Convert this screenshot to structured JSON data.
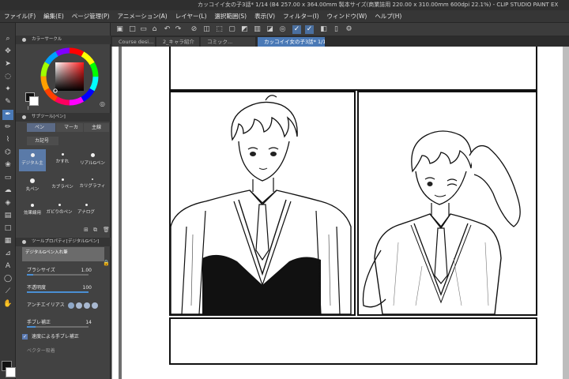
{
  "window": {
    "title": "カッコイイ女の子3話* 1/14 (B4 257.00 x 364.00mm 製本サイズ(商業誌用 220.00 x 310.00mm 600dpi 22.1%) - CLIP STUDIO PAINT EX"
  },
  "menu": [
    "ファイル(F)",
    "編集(E)",
    "ページ管理(P)",
    "アニメーション(A)",
    "レイヤー(L)",
    "選択範囲(S)",
    "表示(V)",
    "フィルター(I)",
    "ウィンドウ(W)",
    "ヘルプ(H)"
  ],
  "tabs": [
    {
      "label": "Course desi...",
      "active": false
    },
    {
      "label": "2_キャラ紹介",
      "active": false
    },
    {
      "label": "コミック...",
      "active": false
    },
    {
      "label": "カッコイイ女の子3話* 1/14",
      "active": true
    }
  ],
  "color_circle": {
    "title": "カラーサークル",
    "main_color": "#111111",
    "sub_color": "#ffffff"
  },
  "sub_tool": {
    "title": "サブツール[ペン]",
    "tabs": [
      "ペン",
      "マーカ",
      "主線"
    ],
    "group_label": "カ記号",
    "brushes": [
      "デジタル主",
      "かすれ",
      "リアルGペン",
      "丸ペン",
      "カブラペン",
      "カリグラフィ",
      "効果線用",
      "ガビりのペン",
      "アナログ"
    ]
  },
  "tool_property": {
    "title": "ツールプロパティ[デジタルGペン]",
    "preset_name": "デジタルGペン入れ筆",
    "brush_size": {
      "label": "ブラシサイズ",
      "value": "1.00"
    },
    "opacity": {
      "label": "不透明度",
      "value": "100"
    },
    "antialias": {
      "label": "アンチエイリアス"
    },
    "stabilization": {
      "label": "手ブレ補正",
      "value": "14"
    },
    "speed_correction": {
      "label": "速度による手ブレ補正",
      "checked": true
    },
    "vector_eraser": {
      "label": "ベクター吸着"
    }
  }
}
